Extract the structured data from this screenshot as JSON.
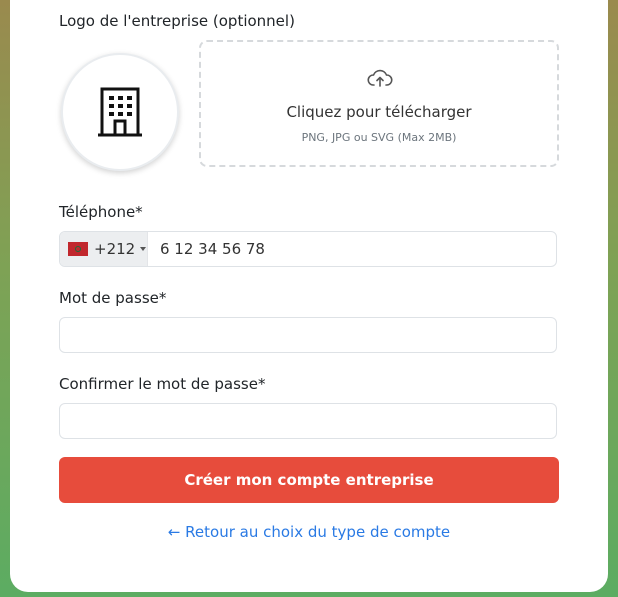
{
  "logo": {
    "label": "Logo de l'entreprise (optionnel)",
    "placeholder_icon": "building-icon",
    "upload": {
      "icon": "cloud-upload-icon",
      "title": "Cliquez pour télécharger",
      "hint": "PNG, JPG ou SVG (Max 2MB)"
    }
  },
  "phone": {
    "label": "Téléphone*",
    "country_flag": "morocco-flag-icon",
    "dial_code": "+212",
    "value": "6 12 34 56 78"
  },
  "password": {
    "label": "Mot de passe*",
    "value": ""
  },
  "confirm_password": {
    "label": "Confirmer le mot de passe*",
    "value": ""
  },
  "submit": {
    "label": "Créer mon compte entreprise"
  },
  "back_link": {
    "label": "← Retour au choix du type de compte"
  },
  "colors": {
    "accent": "#e74c3c",
    "link": "#2a7ae4",
    "background_top": "#9a8a4e",
    "background_bottom": "#5cac62"
  }
}
